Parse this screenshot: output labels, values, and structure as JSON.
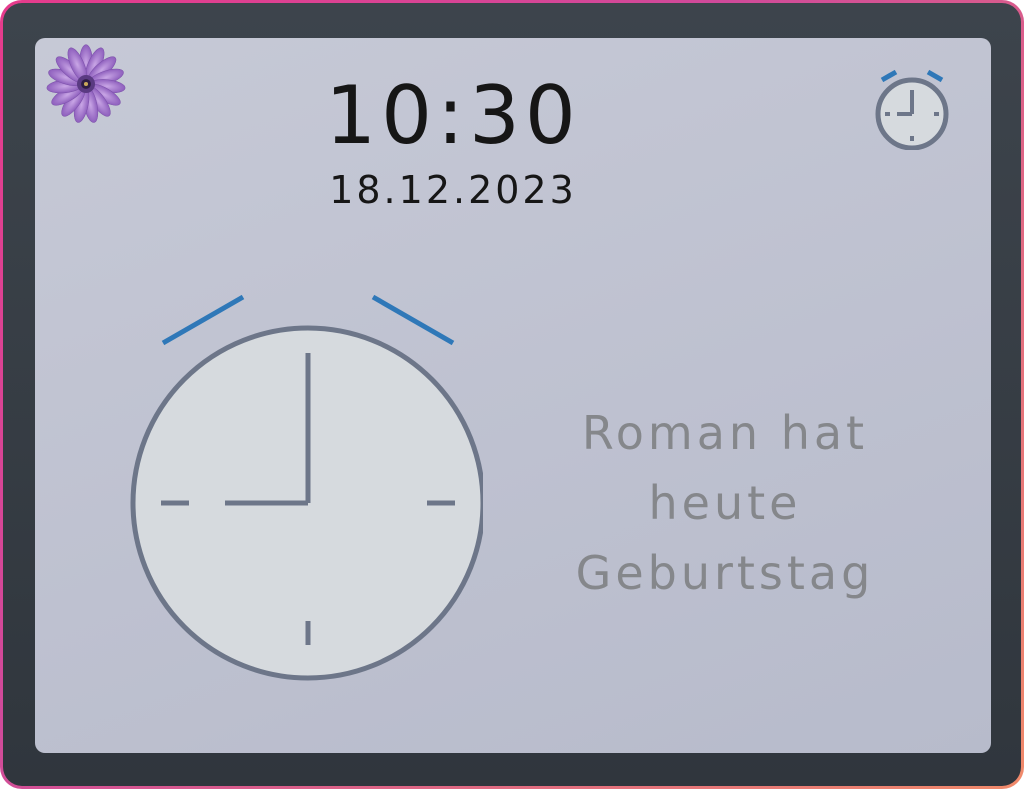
{
  "status": {
    "time": "10:30",
    "date": "18.12.2023"
  },
  "icons": {
    "flower": "flower-icon",
    "alarm": "alarm-clock-icon",
    "clock": "analog-clock-icon"
  },
  "clock": {
    "hour": 9,
    "minute": 0
  },
  "message": {
    "line1": "Roman hat",
    "line2": "heute",
    "line3": "Geburtstag"
  },
  "colors": {
    "accent_blue": "#2f78b8",
    "clock_stroke": "#6d7689",
    "clock_face": "#d6dade",
    "message_text": "#85878b",
    "flower_petal": "#9a6ec0",
    "flower_center": "#4a2f6b"
  }
}
